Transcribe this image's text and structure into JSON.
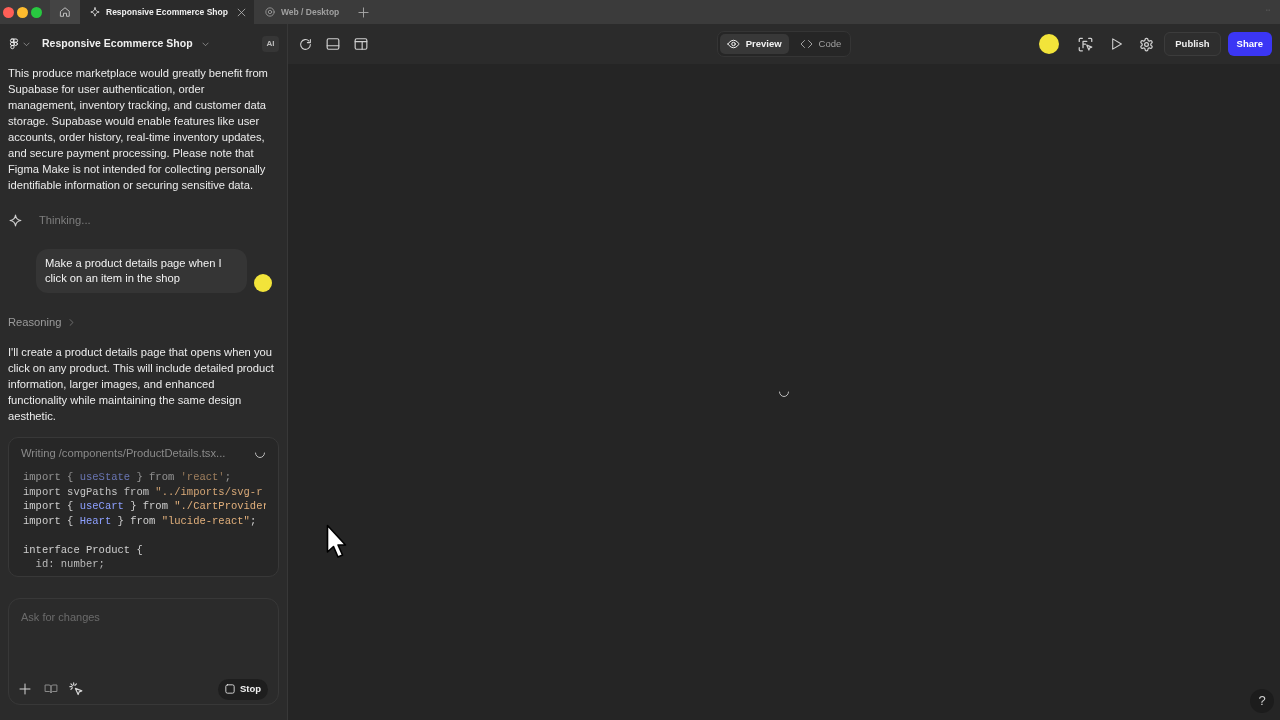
{
  "browser_tabs": [
    {
      "label": "Responsive Ecommerce Shop",
      "selected": true,
      "kind": "make"
    },
    {
      "label": "Web / Desktop",
      "selected": false,
      "kind": "design"
    }
  ],
  "project": {
    "title": "Responsive Ecommerce Shop",
    "badge": "AI"
  },
  "chat": [
    {
      "kind": "assistant_text",
      "text": "This produce marketplace would greatly benefit from Supabase for user authentication, order management, inventory tracking, and customer data storage. Supabase would enable features like user accounts, order history, real-time inventory updates, and secure payment processing. Please note that Figma Make is not intended for collecting personally identifiable information or securing sensitive data."
    },
    {
      "kind": "status",
      "text": "Thinking..."
    },
    {
      "kind": "user_message",
      "text": "Make a product details page when I click on an item in the shop"
    },
    {
      "kind": "disclosure",
      "text": "Reasoning",
      "expanded": false
    },
    {
      "kind": "assistant_text",
      "text": "I'll create a product details page that opens when you click on any product. This will include detailed product information, larger images, and enhanced functionality while maintaining the same design aesthetic."
    },
    {
      "kind": "file_write",
      "title": "Writing /components/ProductDetails.tsx...",
      "lines": [
        {
          "kind": "code",
          "tokens": [
            {
              "text": "import { ",
              "kind": "plain"
            },
            {
              "text": "useState",
              "kind": "ident"
            },
            {
              "text": " } from ",
              "kind": "plain"
            },
            {
              "text": "'react'",
              "kind": "string"
            },
            {
              "text": ";",
              "kind": "plain"
            }
          ]
        },
        {
          "kind": "code",
          "tokens": [
            {
              "text": "import svgPaths from ",
              "kind": "plain"
            },
            {
              "text": "\"../imports/svg-r",
              "kind": "string"
            }
          ]
        },
        {
          "kind": "code",
          "tokens": [
            {
              "text": "import { ",
              "kind": "plain"
            },
            {
              "text": "useCart",
              "kind": "ident"
            },
            {
              "text": " } from ",
              "kind": "plain"
            },
            {
              "text": "\"./CartProvider",
              "kind": "string"
            }
          ]
        },
        {
          "kind": "code",
          "tokens": [
            {
              "text": "import { ",
              "kind": "plain"
            },
            {
              "text": "Heart",
              "kind": "ident"
            },
            {
              "text": " } from ",
              "kind": "plain"
            },
            {
              "text": "\"lucide-react\"",
              "kind": "string"
            },
            {
              "text": ";",
              "kind": "plain"
            }
          ]
        },
        {
          "kind": "blank"
        },
        {
          "kind": "code",
          "tokens": [
            {
              "text": "interface Product {",
              "kind": "plain"
            }
          ]
        },
        {
          "kind": "code",
          "tokens": [
            {
              "text": "  id: number;",
              "kind": "plain"
            }
          ]
        }
      ]
    }
  ],
  "composer": {
    "placeholder": "Ask for changes",
    "stop_label": "Stop"
  },
  "toolbar": {
    "modes": [
      {
        "label": "Preview",
        "selected": true,
        "kind": "preview"
      },
      {
        "label": "Code",
        "selected": false,
        "kind": "code"
      }
    ],
    "publish_label": "Publish",
    "share_label": "Share"
  },
  "help_label": "?"
}
